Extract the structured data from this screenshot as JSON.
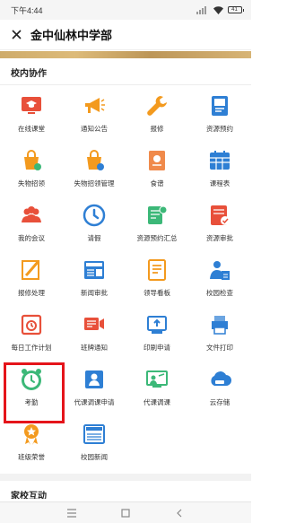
{
  "status_bar": {
    "time": "下午4:44",
    "battery": "41"
  },
  "header": {
    "title": "金中仙林中学部"
  },
  "section1": {
    "title": "校内协作"
  },
  "apps": [
    {
      "label": "在线课堂",
      "icon": "online-class-icon",
      "color": "#e8503a"
    },
    {
      "label": "通知公告",
      "icon": "megaphone-icon",
      "color": "#f39a1e"
    },
    {
      "label": "报修",
      "icon": "wrench-icon",
      "color": "#f39a1e"
    },
    {
      "label": "资源预约",
      "icon": "reservation-icon",
      "color": "#2e7fd4"
    },
    {
      "label": "失物招领",
      "icon": "lost-found-icon",
      "color": "#f39a1e"
    },
    {
      "label": "失物招领管理",
      "icon": "lost-found-manage-icon",
      "color": "#f39a1e"
    },
    {
      "label": "食谱",
      "icon": "recipe-icon",
      "color": "#f08a4b"
    },
    {
      "label": "课程表",
      "icon": "timetable-icon",
      "color": "#2e7fd4"
    },
    {
      "label": "我的会议",
      "icon": "meeting-icon",
      "color": "#e8503a"
    },
    {
      "label": "请假",
      "icon": "clock-icon",
      "color": "#2e7fd4"
    },
    {
      "label": "资源预约汇总",
      "icon": "reservation-summary-icon",
      "color": "#3cb878"
    },
    {
      "label": "资源审批",
      "icon": "resource-approve-icon",
      "color": "#e8503a"
    },
    {
      "label": "报修处理",
      "icon": "repair-handle-icon",
      "color": "#f39a1e"
    },
    {
      "label": "新闻审批",
      "icon": "news-approve-icon",
      "color": "#2e7fd4"
    },
    {
      "label": "领导看板",
      "icon": "dashboard-icon",
      "color": "#f39a1e"
    },
    {
      "label": "校园检查",
      "icon": "campus-check-icon",
      "color": "#2e7fd4"
    },
    {
      "label": "每日工作计划",
      "icon": "work-plan-icon",
      "color": "#e8503a"
    },
    {
      "label": "班牌通知",
      "icon": "class-notice-icon",
      "color": "#e8503a"
    },
    {
      "label": "印刷申请",
      "icon": "print-request-icon",
      "color": "#2e7fd4"
    },
    {
      "label": "文件打印",
      "icon": "file-print-icon",
      "color": "#2e7fd4"
    },
    {
      "label": "考勤",
      "icon": "attendance-clock-icon",
      "color": "#3cb878"
    },
    {
      "label": "代课调课申请",
      "icon": "substitute-request-icon",
      "color": "#2e7fd4"
    },
    {
      "label": "代课调课",
      "icon": "substitute-icon",
      "color": "#3cb878"
    },
    {
      "label": "云存储",
      "icon": "cloud-icon",
      "color": "#2e7fd4"
    },
    {
      "label": "班级荣誉",
      "icon": "honor-icon",
      "color": "#f39a1e"
    },
    {
      "label": "校园新闻",
      "icon": "campus-news-icon",
      "color": "#2e7fd4"
    }
  ],
  "section2": {
    "title": "家校互动"
  }
}
